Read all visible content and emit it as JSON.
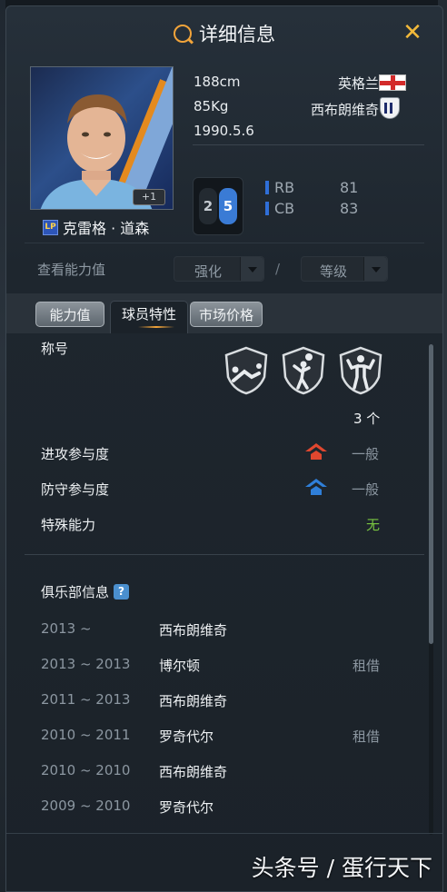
{
  "header": {
    "title": "详细信息",
    "close_label": "✕"
  },
  "player": {
    "name": "克雷格 · 道森",
    "badge": "LP",
    "plus": "+1",
    "height": "188cm",
    "weight": "85Kg",
    "birthdate": "1990.5.6",
    "nation": "英格兰",
    "club": "西布朗维奇"
  },
  "feet": {
    "left": "2",
    "right": "5"
  },
  "positions": [
    {
      "name": "RB",
      "value": "81"
    },
    {
      "name": "CB",
      "value": "83"
    }
  ],
  "ability": {
    "label": "查看能力值",
    "enhance_select": "强化",
    "separator": "/",
    "level_select": "等级"
  },
  "tabs": [
    {
      "label": "能力值",
      "active": false
    },
    {
      "label": "球员特性",
      "active": true
    },
    {
      "label": "市场价格",
      "active": false
    }
  ],
  "traits": {
    "title_label": "称号",
    "icons": [
      "long-throw-icon",
      "header-icon",
      "strength-icon"
    ],
    "count": "3 个"
  },
  "attributes": [
    {
      "label": "进攻参与度",
      "value": "一般",
      "icon": "attack-arrow-icon",
      "icon_color": "#e0472f"
    },
    {
      "label": "防守参与度",
      "value": "一般",
      "icon": "defend-arrow-icon",
      "icon_color": "#2f7fd9"
    },
    {
      "label": "特殊能力",
      "value": "无",
      "value_color": "#79c441"
    }
  ],
  "club_history": {
    "title": "俱乐部信息",
    "help": "?",
    "rows": [
      {
        "period": "2013 ~",
        "club": "西布朗维奇",
        "note": ""
      },
      {
        "period": "2013 ~ 2013",
        "club": "博尔顿",
        "note": "租借"
      },
      {
        "period": "2011 ~ 2013",
        "club": "西布朗维奇",
        "note": ""
      },
      {
        "period": "2010 ~ 2011",
        "club": "罗奇代尔",
        "note": "租借"
      },
      {
        "period": "2010 ~ 2010",
        "club": "西布朗维奇",
        "note": ""
      },
      {
        "period": "2009 ~ 2010",
        "club": "罗奇代尔",
        "note": ""
      }
    ]
  },
  "watermark": "头条号 / 蛋行天下",
  "colors": {
    "accent": "#f2a43a",
    "foot_active": "#3a7bd5",
    "position_bar": "#2f6fd8"
  }
}
